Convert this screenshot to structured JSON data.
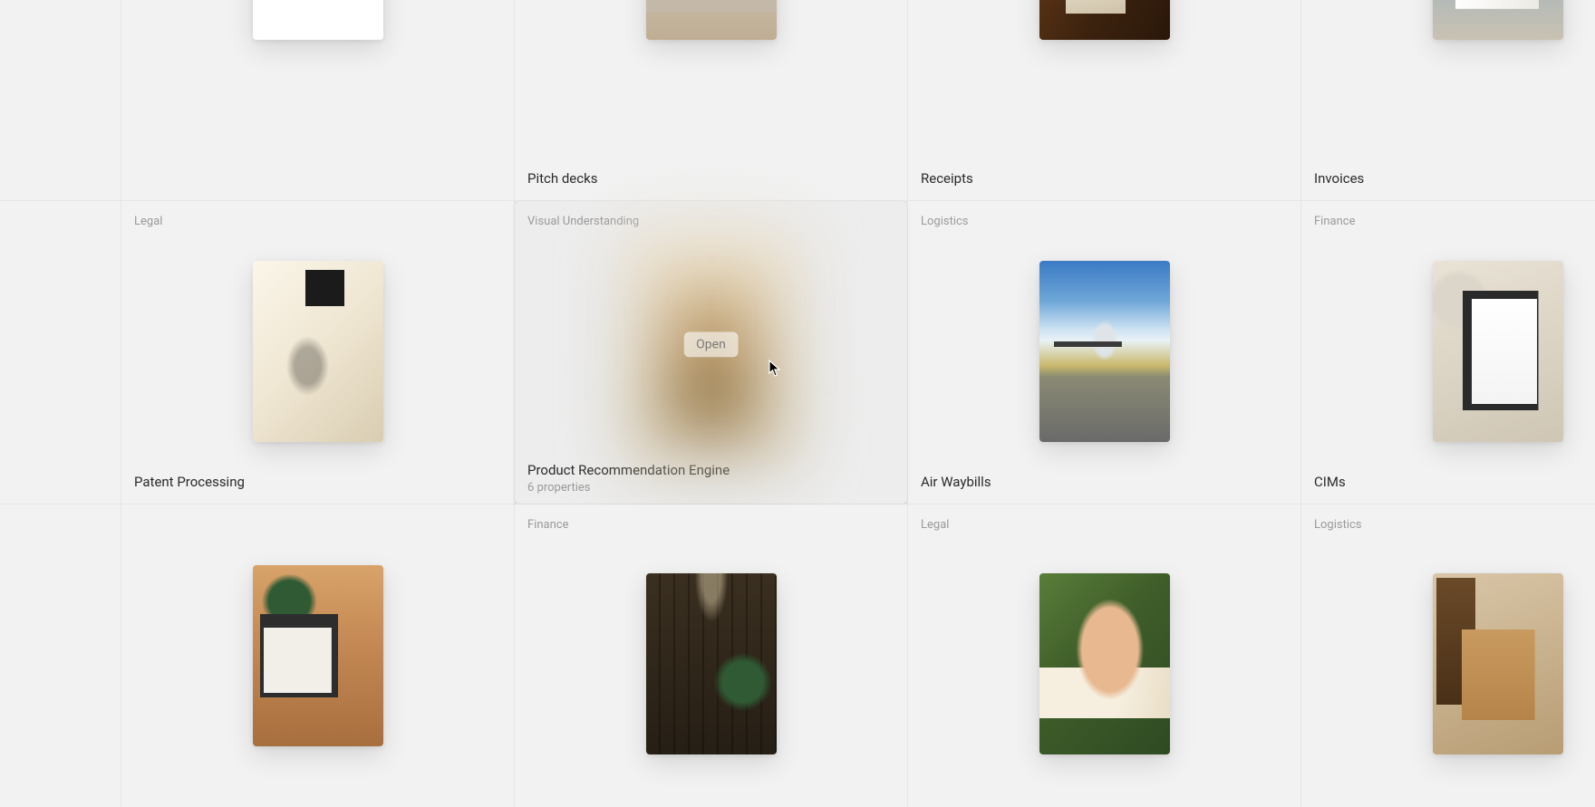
{
  "open_label": "Open",
  "cards": [
    {
      "tag": "",
      "title": "",
      "thumb": "doc",
      "row": "top"
    },
    {
      "tag": "",
      "title": "Pitch decks",
      "thumb": "th-pitch",
      "row": "top"
    },
    {
      "tag": "",
      "title": "Receipts",
      "thumb": "th-receipt",
      "row": "top"
    },
    {
      "tag": "",
      "title": "Invoices",
      "thumb": "th-invoice",
      "row": "top"
    },
    {
      "tag": "Legal",
      "title": "Patent Processing",
      "thumb": "th-patent",
      "row": "mid"
    },
    {
      "tag": "Visual Understanding",
      "title": "Product Recommendation Engine",
      "subtitle": "6 properties",
      "thumb": "th-product",
      "row": "mid",
      "hover": true
    },
    {
      "tag": "Logistics",
      "title": "Air Waybills",
      "thumb": "th-awb",
      "row": "mid"
    },
    {
      "tag": "Finance",
      "title": "CIMs",
      "thumb": "th-cim",
      "row": "mid"
    },
    {
      "tag": "",
      "title": "",
      "thumb": "th-laptop",
      "row": "bot"
    },
    {
      "tag": "Finance",
      "title": "",
      "thumb": "th-archive",
      "row": "bot"
    },
    {
      "tag": "Legal",
      "title": "",
      "thumb": "th-sign",
      "row": "bot"
    },
    {
      "tag": "Logistics",
      "title": "",
      "thumb": "th-boxes",
      "row": "bot"
    }
  ]
}
